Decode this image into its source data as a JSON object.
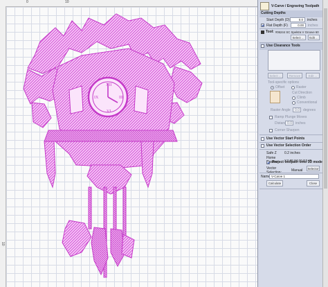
{
  "rulers": {
    "top_labels": [
      "0",
      "10"
    ],
    "left_labels": [
      "10"
    ]
  },
  "panel": {
    "title": "V-Carve / Engraving Toolpath",
    "cutting_depths": {
      "heading": "Cutting Depths",
      "start_depth_label": "Start Depth (D)",
      "start_depth_value": "0.0",
      "units": "inches",
      "flat_depth_label": "Flat Depth (F)",
      "flat_depth_value": "0.00",
      "flat_depth_unit": "inches",
      "flat_depth_checked": true
    },
    "tool": {
      "label": "Tool:",
      "name": "#06244 SC Spektra V Groove 60",
      "select_label": "Select ...",
      "edit_label": "Edit ..."
    },
    "clearance": {
      "label": "Use Clearance Tools",
      "checked": false,
      "select_label": "Select ...",
      "remove_label": "Remove",
      "edit_label": "Edit ...",
      "tool_specific_options": "Tool-specific options",
      "offset_label": "Offset",
      "raster_label": "Raster",
      "cut_direction": "Cut Direction",
      "climb_label": "Climb",
      "conventional_label": "Conventional",
      "raster_angle_label": "Raster Angle",
      "raster_angle_value": "0.0",
      "degrees": "degrees",
      "ramp_label": "Ramp Plunge Moves",
      "distance_label": "Distance",
      "distance_value": "0.0",
      "inches": "inches",
      "corner_label": "Corner Sharpen"
    },
    "options": {
      "vector_start_points": "Use Vector Start Points",
      "vector_selection_order": "Use Vector Selection Order"
    },
    "positions": {
      "safe_z_label": "Safe Z",
      "safe_z_value": "0.2 inches",
      "home_label": "Home Position",
      "home_value": "X:0.00 Y:0.00 Z:0.20",
      "project_label": "Project toolpath onto 3D model",
      "vector_selection_label": "Vector Selection:",
      "vector_selection_value": "Manual",
      "selector_label": "Selector ..."
    },
    "name": {
      "label": "Name:",
      "value": "V-Carve 1"
    },
    "calculate_label": "Calculate",
    "close_label": "Close"
  },
  "colors": {
    "art": "#d24fd6",
    "art_light": "#f1b6f2",
    "accent": "#1c3fa0"
  }
}
